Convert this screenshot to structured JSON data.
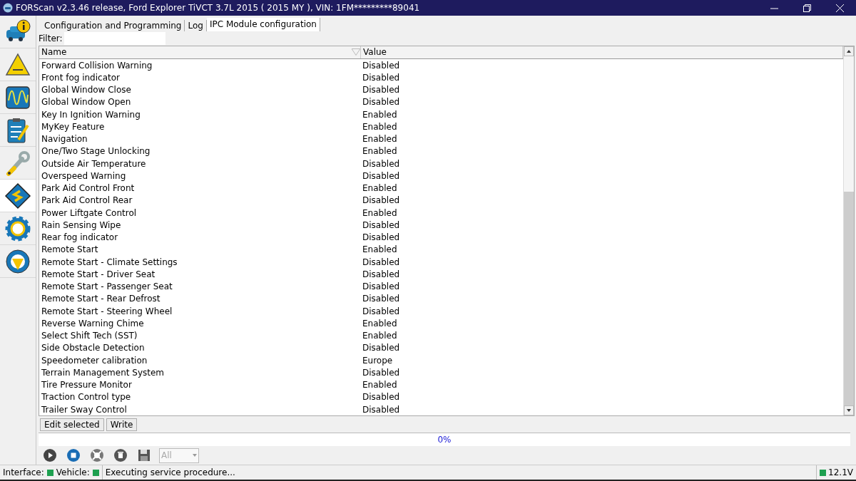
{
  "window": {
    "title": "FORScan v2.3.46 release, Ford Explorer TiVCT 3.7L 2015 ( 2015 MY ), VIN: 1FM*********89041"
  },
  "sidebar": {
    "items": [
      {
        "kind": "info",
        "selected": false
      },
      {
        "kind": "dtc",
        "selected": false
      },
      {
        "kind": "scope",
        "selected": false
      },
      {
        "kind": "checklist",
        "selected": false
      },
      {
        "kind": "wrench",
        "selected": false
      },
      {
        "kind": "chip",
        "selected": true
      },
      {
        "kind": "gear",
        "selected": false
      },
      {
        "kind": "help",
        "selected": false
      }
    ]
  },
  "tabs": [
    {
      "label": "Configuration and Programming",
      "selected": false
    },
    {
      "label": "Log",
      "selected": false
    },
    {
      "label": "IPC Module configuration",
      "selected": true
    }
  ],
  "filter": {
    "label": "Filter:"
  },
  "table": {
    "columns": [
      "Name",
      "Value"
    ],
    "rows": [
      [
        "Forward Collision Warning",
        "Disabled"
      ],
      [
        "Front fog indicator",
        "Disabled"
      ],
      [
        "Global Window Close",
        "Disabled"
      ],
      [
        "Global Window Open",
        "Disabled"
      ],
      [
        "Key In Ignition Warning",
        "Enabled"
      ],
      [
        "MyKey Feature",
        "Enabled"
      ],
      [
        "Navigation",
        "Enabled"
      ],
      [
        "One/Two Stage Unlocking",
        "Enabled"
      ],
      [
        "Outside Air Temperature",
        "Disabled"
      ],
      [
        "Overspeed Warning",
        "Disabled"
      ],
      [
        "Park Aid Control Front",
        "Enabled"
      ],
      [
        "Park Aid Control Rear",
        "Disabled"
      ],
      [
        "Power Liftgate Control",
        "Enabled"
      ],
      [
        "Rain Sensing Wipe",
        "Disabled"
      ],
      [
        "Rear fog indicator",
        "Disabled"
      ],
      [
        "Remote Start",
        "Enabled"
      ],
      [
        "Remote Start - Climate Settings",
        "Disabled"
      ],
      [
        "Remote Start - Driver Seat",
        "Disabled"
      ],
      [
        "Remote Start - Passenger Seat",
        "Disabled"
      ],
      [
        "Remote Start - Rear Defrost",
        "Disabled"
      ],
      [
        "Remote Start - Steering Wheel",
        "Disabled"
      ],
      [
        "Reverse Warning Chime",
        "Enabled"
      ],
      [
        "Select Shift Tech (SST)",
        "Enabled"
      ],
      [
        "Side Obstacle Detection",
        "Disabled"
      ],
      [
        "Speedometer calibration",
        "Europe"
      ],
      [
        "Terrain Management System",
        "Disabled"
      ],
      [
        "Tire Pressure Monitor",
        "Enabled"
      ],
      [
        "Traction Control type",
        "Disabled"
      ],
      [
        "Trailer Sway Control",
        "Disabled"
      ]
    ]
  },
  "actions": [
    "Edit selected",
    "Write"
  ],
  "progress": {
    "text": "0%",
    "level": 0
  },
  "toolbar": {
    "buttons": [
      {
        "kind": "play"
      },
      {
        "kind": "stop"
      },
      {
        "kind": "disconnect"
      },
      {
        "kind": "trash"
      },
      {
        "kind": "save"
      }
    ],
    "dropdown": {
      "value": "All",
      "disabled": true
    }
  },
  "status_bar": {
    "indicators": [
      {
        "label": "Interface:",
        "color": "#1ea050"
      },
      {
        "label": "Vehicle:",
        "color": "#1ea050"
      }
    ],
    "message": "Executing service procedure...",
    "voltage": {
      "text": "12.1V",
      "color": "#1ea050"
    }
  }
}
